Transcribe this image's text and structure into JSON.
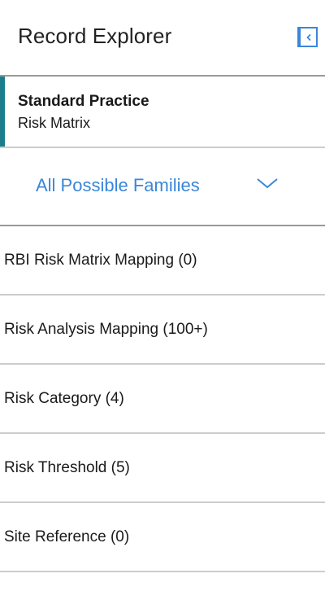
{
  "panel": {
    "title": "Record Explorer",
    "collapse_icon": "chevron-left-icon",
    "accent_color": "#3a86d8"
  },
  "context": {
    "title": "Standard Practice",
    "subtitle": "Risk Matrix",
    "accent_color": "#1a7f8a"
  },
  "families": {
    "selected": "All Possible Families",
    "chevron_icon": "chevron-down-icon"
  },
  "list": {
    "items": [
      {
        "label": "RBI Risk Matrix Mapping (0)"
      },
      {
        "label": "Risk Analysis Mapping (100+)"
      },
      {
        "label": "Risk Category (4)"
      },
      {
        "label": "Risk Threshold (5)"
      },
      {
        "label": "Site Reference (0)"
      }
    ]
  }
}
